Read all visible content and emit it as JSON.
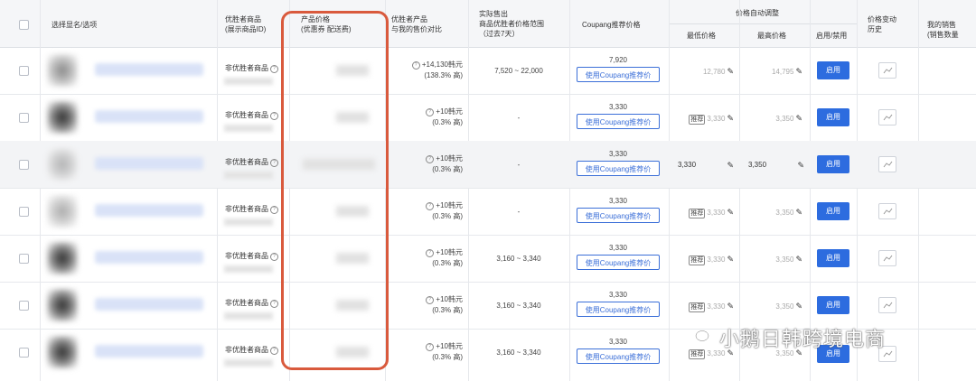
{
  "headers": {
    "product_name": "选择显名/选项",
    "winner_product": "优胜者商品\n(展示商品ID)",
    "product_price": "产品价格\n(优惠券 配送费)",
    "winner_diff": "优胜者产品\n与我的售价对比",
    "actual_range": "实际售出\n商品优胜者价格范围\n（过去7天）",
    "coupang_rec": "Coupang推荐价格",
    "auto_adjust": "价格自动调整",
    "min_price": "最低价格",
    "max_price": "最高价格",
    "enable_col": "启用/禁用",
    "price_history": "价格变动\n历史",
    "my_sales": "我的销售\n(销售数量"
  },
  "rows": [
    {
      "status": "非优胜者商品",
      "diff": "+14,130韩元",
      "diff_pct": "(138.3% 高)",
      "range": "7,520 ~ 22,000",
      "rec_price": "7,920",
      "rec_btn": "使用Coupang推荐价",
      "min": "12,780",
      "max": "14,795",
      "min_tag": "",
      "enable": "启用"
    },
    {
      "status": "非优胜者商品",
      "diff": "+10韩元",
      "diff_pct": "(0.3% 高)",
      "range": "-",
      "rec_price": "3,330",
      "rec_btn": "使用Coupang推荐价",
      "min": "3,330",
      "max": "3,350",
      "min_tag": "推荐",
      "enable": "启用"
    },
    {
      "status": "非优胜者商品",
      "diff": "+10韩元",
      "diff_pct": "(0.3% 高)",
      "range": "-",
      "rec_price": "3,330",
      "rec_btn": "使用Coupang推荐价",
      "min": "3,330",
      "max": "3,350",
      "min_tag": "",
      "enable": "启用"
    },
    {
      "status": "非优胜者商品",
      "diff": "+10韩元",
      "diff_pct": "(0.3% 高)",
      "range": "-",
      "rec_price": "3,330",
      "rec_btn": "使用Coupang推荐价",
      "min": "3,330",
      "max": "3,350",
      "min_tag": "推荐",
      "enable": "启用"
    },
    {
      "status": "非优胜者商品",
      "diff": "+10韩元",
      "diff_pct": "(0.3% 高)",
      "range": "3,160 ~ 3,340",
      "rec_price": "3,330",
      "rec_btn": "使用Coupang推荐价",
      "min": "3,330",
      "max": "3,350",
      "min_tag": "推荐",
      "enable": "启用"
    },
    {
      "status": "非优胜者商品",
      "diff": "+10韩元",
      "diff_pct": "(0.3% 高)",
      "range": "3,160 ~ 3,340",
      "rec_price": "3,330",
      "rec_btn": "使用Coupang推荐价",
      "min": "3,330",
      "max": "3,350",
      "min_tag": "推荐",
      "enable": "启用"
    },
    {
      "status": "非优胜者商品",
      "diff": "+10韩元",
      "diff_pct": "(0.3% 高)",
      "range": "3,160 ~ 3,340",
      "rec_price": "3,330",
      "rec_btn": "使用Coupang推荐价",
      "min": "3,330",
      "max": "3,350",
      "min_tag": "推荐",
      "enable": "启用"
    }
  ],
  "watermark": "小鹅日韩跨境电商",
  "colors": {
    "accent": "#2d6cdf",
    "highlight_box": "#d95a3d"
  }
}
